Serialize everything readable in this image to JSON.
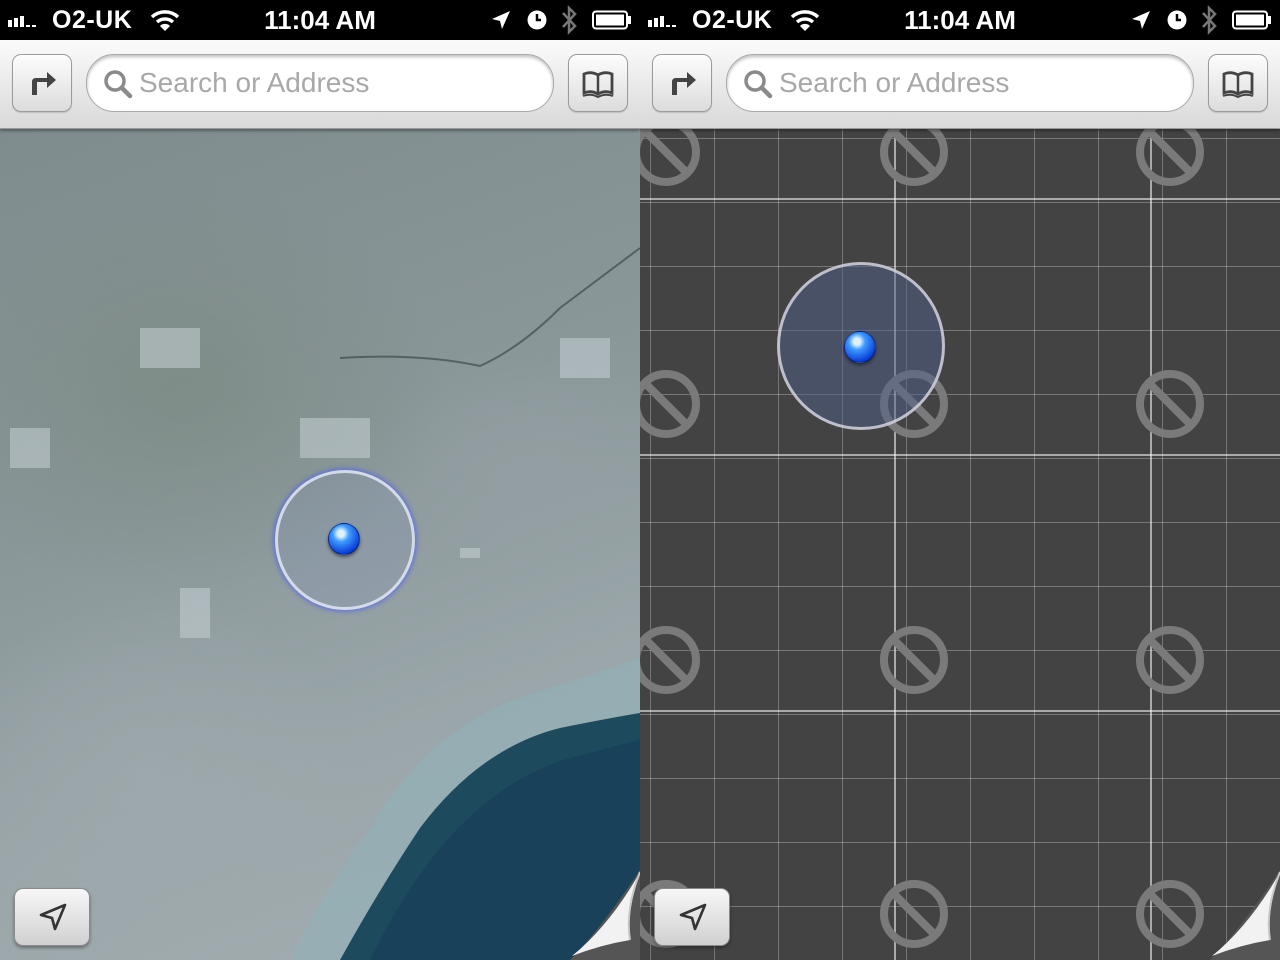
{
  "status_bar": {
    "carrier": "O2-UK",
    "time": "11:04 AM",
    "icons": [
      "signal-bars-icon",
      "wifi-icon",
      "location-arrow-icon",
      "alarm-clock-icon",
      "bluetooth-icon",
      "battery-icon"
    ]
  },
  "toolbar": {
    "directions_icon": "directions-arrow-icon",
    "bookmarks_icon": "book-icon",
    "search": {
      "placeholder": "Search or Address",
      "value": ""
    }
  },
  "screens": [
    {
      "view": "satellite",
      "tiles_loaded": true
    },
    {
      "view": "standard",
      "tiles_loaded": false,
      "placeholder_icon": "no-entry-icon"
    }
  ],
  "map_controls": {
    "locate_icon": "location-arrow-icon",
    "page_curl_icon": "page-curl-icon"
  },
  "colors": {
    "location_dot": "#0a5cff",
    "grid_background": "#434343",
    "toolbar": "#e8e8e8"
  }
}
